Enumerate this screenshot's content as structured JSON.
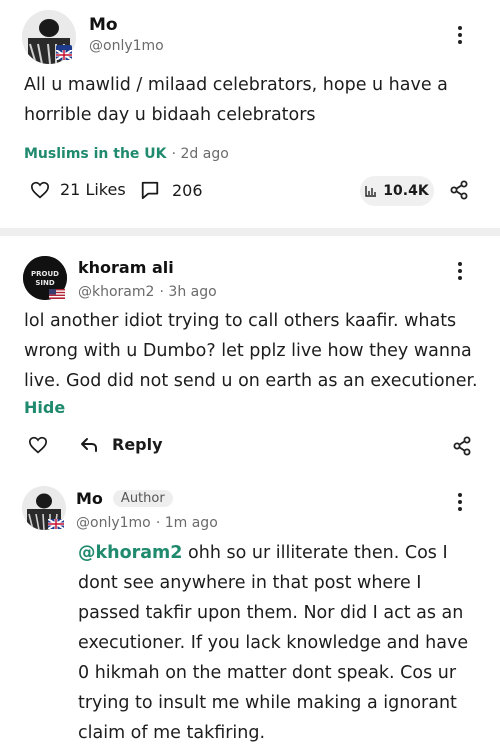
{
  "post": {
    "author_name": "Mo",
    "author_handle": "@only1mo",
    "text": "All u mawlid / milaad celebrators, hope u have a horrible day u bidaah celebrators",
    "community": "Muslims in the UK",
    "time": "· 2d ago",
    "likes": "21 Likes",
    "comments": "206",
    "views": "10.4K"
  },
  "comment1": {
    "author_name": "khoram ali",
    "author_handle": "@khoram2",
    "time": "· 3h ago",
    "avatar_text": "PROUD SIND",
    "text": "lol another idiot trying to call others kaafir. whats wrong with u Dumbo? let pplz live how they wanna live. God  did not send u on earth as an executioner.",
    "hide_label": "Hide",
    "reply_label": "Reply"
  },
  "comment2": {
    "author_name": "Mo",
    "badge": "Author",
    "author_handle": "@only1mo",
    "time": "· 1m ago",
    "mention": "@khoram2",
    "text": " ohh so ur illiterate then. Cos I dont see anywhere in that post where I passed takfir upon them. Nor did I act as an executioner. If you lack knowledge and have 0 hikmah on the matter dont speak. Cos ur trying to insult me while making a ignorant claim of me takfiring."
  },
  "colors": {
    "accent": "#1f8a6e",
    "divider": "#eeeeee"
  }
}
